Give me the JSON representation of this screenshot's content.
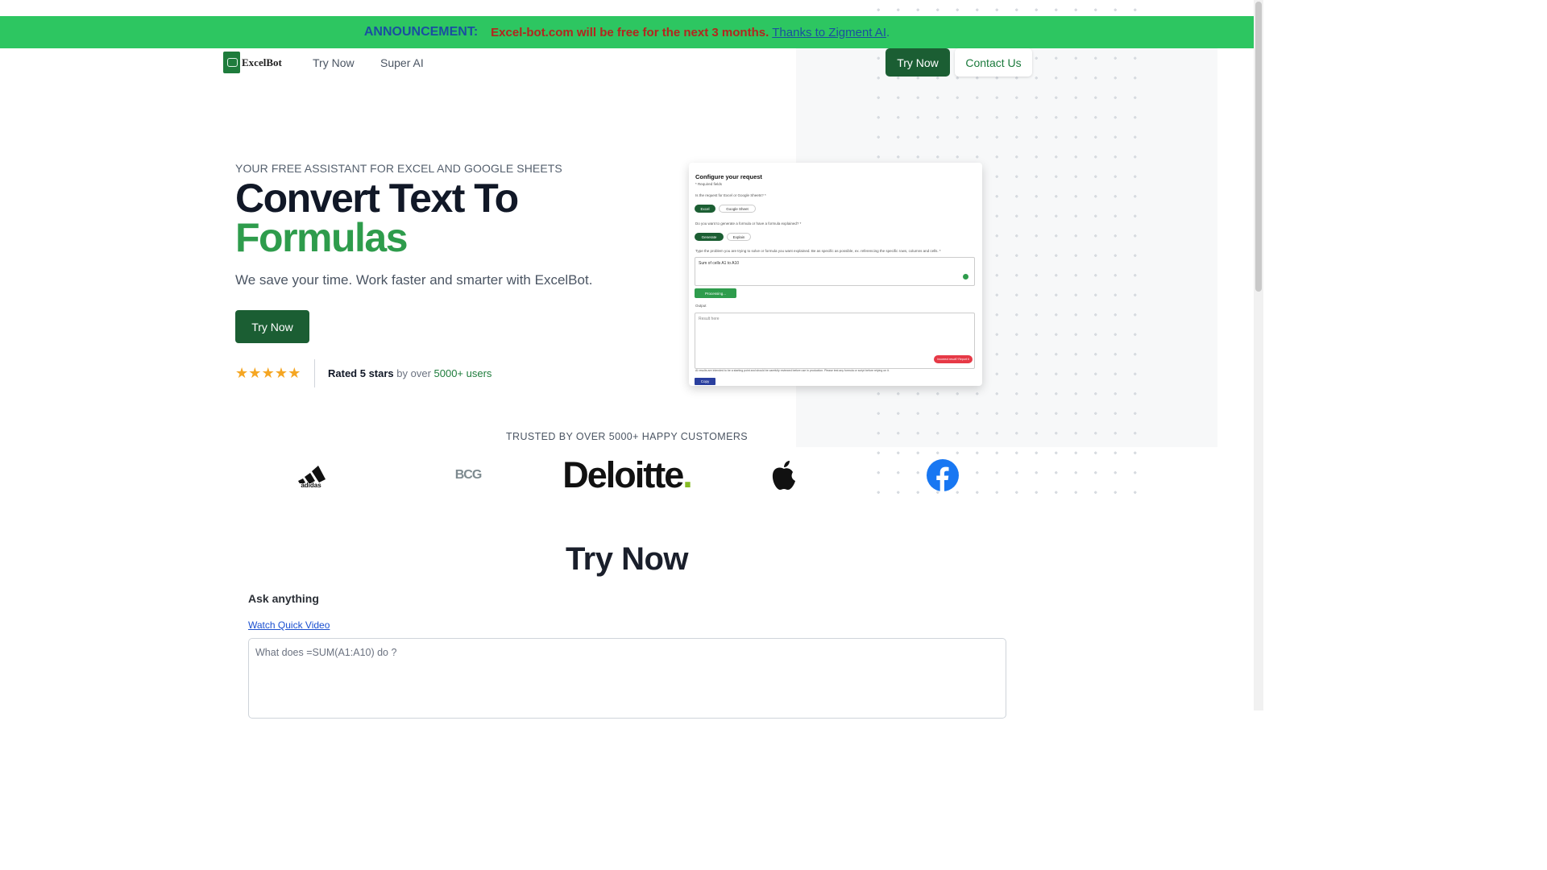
{
  "announcement": {
    "label": "ANNOUNCEMENT:",
    "message": "Excel-bot.com will be free for the next 3 months.",
    "link": "Thanks to Zigment AI",
    "suffix": "."
  },
  "nav": {
    "logo_text": "ExcelBot",
    "links": [
      "Try Now",
      "Super AI"
    ],
    "try_button": "Try Now",
    "contact_button": "Contact Us"
  },
  "hero": {
    "eyebrow": "YOUR FREE ASSISTANT FOR EXCEL AND GOOGLE SHEETS",
    "title_line1": "Convert Text To",
    "title_line2": "Formulas",
    "subtitle": "We save your time. Work faster and smarter with ExcelBot.",
    "cta": "Try Now",
    "star_glyph": "★",
    "stars_count": 5,
    "rating_bold": "Rated 5 stars",
    "rating_mid": " by over ",
    "rating_green": "5000+ users"
  },
  "mockup": {
    "title": "Configure your request",
    "required_note": "* Required fields",
    "q1": "Is the request for Excel or Google Sheets? *",
    "q1_options": [
      "Excel",
      "Google Sheet"
    ],
    "q2": "Do you want to generate a formula or have a formula explained? *",
    "q2_options": [
      "Generate",
      "Explain"
    ],
    "q3": "Type the problem you are trying to solve or formula you want explained. Be as specific as possible, ex. referencing the specific rows, columns and cells. *",
    "input_value": "Sum of cells A1 to A10",
    "processing": "Processing...",
    "output_label": "Output",
    "output_placeholder": "Result here",
    "report_button": "Incorrect result? Report it",
    "disclaimer": "AI results are intended to be a starting point and should be carefully reviewed before use in production. Please test any formula or script before relying on it.",
    "copy": "Copy"
  },
  "trusted": {
    "heading": "TRUSTED BY OVER 5000+ HAPPY CUSTOMERS",
    "brands": [
      "adidas",
      "BCG",
      "Deloitte",
      "apple",
      "facebook"
    ],
    "bcg_text": "BCG",
    "deloitte_text": "Deloitte",
    "deloitte_dot": "."
  },
  "try_section": {
    "title": "Try Now",
    "ask_label": "Ask anything",
    "video_link": "Watch Quick Video",
    "placeholder": "What does =SUM(A1:A10) do ?"
  },
  "colors": {
    "announce_bg": "#2dc661",
    "brand_green": "#1b5e33",
    "accent_green": "#2e9c4c",
    "star": "#f5a623"
  }
}
